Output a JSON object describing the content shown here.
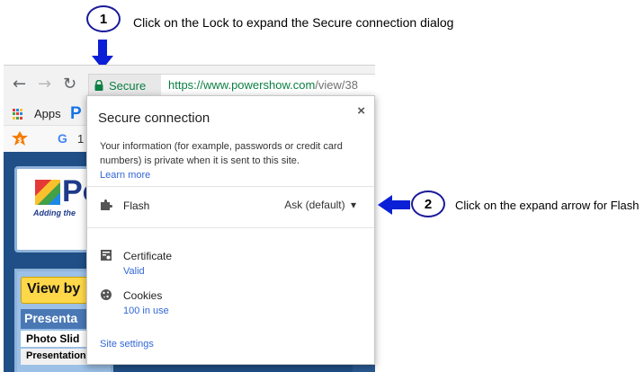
{
  "annotations": {
    "step1": {
      "number": "1",
      "text": "Click on the Lock to expand the Secure connection dialog"
    },
    "step2": {
      "number": "2",
      "text": "Click on the expand arrow for Flash"
    }
  },
  "browser": {
    "omnibox": {
      "secure_label": "Secure",
      "url_scheme_host": "https://www.powershow.com",
      "url_path": "/view/38"
    },
    "bookmarks": {
      "apps_label": "Apps"
    },
    "extension_row": {
      "fragment": "1"
    }
  },
  "popup": {
    "title": "Secure connection",
    "close_glyph": "×",
    "description": "Your information (for example, passwords or credit card numbers) is private when it is sent to this site.",
    "learn_more": "Learn more",
    "flash": {
      "label": "Flash",
      "value": "Ask (default)",
      "caret": "▾"
    },
    "certificate": {
      "label": "Certificate",
      "status": "Valid"
    },
    "cookies": {
      "label": "Cookies",
      "count": "100 in use"
    },
    "site_settings": "Site settings"
  },
  "page_behind": {
    "logo_word": "Po",
    "logo_tag": "Adding the",
    "view_by": "View by",
    "presenta": "Presenta",
    "photo_slide": "Photo Slid",
    "presentations": "Presentations"
  },
  "colors": {
    "secure_green": "#0b8043",
    "link_blue": "#3367d6",
    "arrow_blue": "#0a1fd6"
  }
}
